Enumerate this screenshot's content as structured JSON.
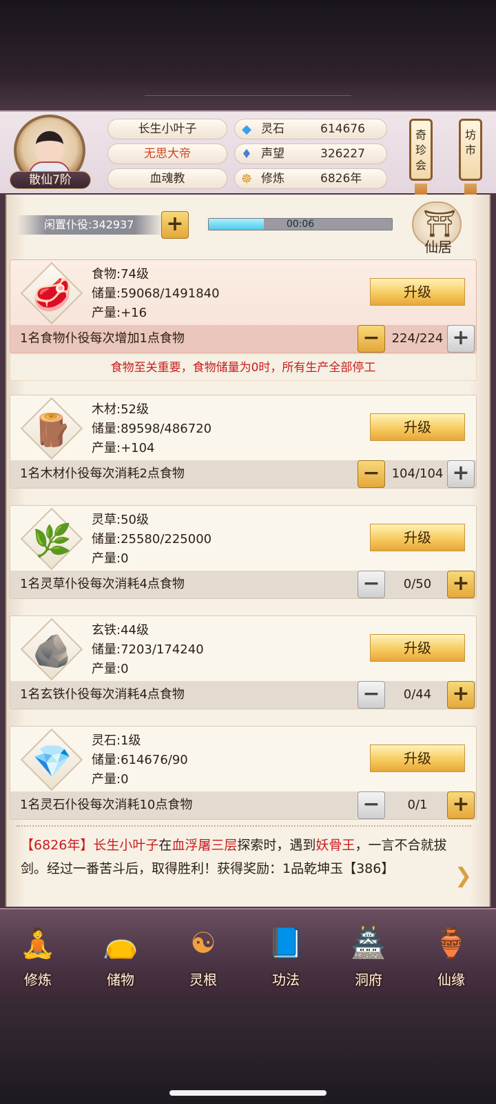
{
  "header": {
    "rank": "散仙7阶",
    "player_name": "长生小叶子",
    "title": "无思大帝",
    "sect": "血魂教",
    "stats": [
      {
        "label": "灵石",
        "value": "614676",
        "icon": "spirit-stone-icon",
        "glyph": "◆",
        "color": "#3aa0e8"
      },
      {
        "label": "声望",
        "value": "326227",
        "icon": "prestige-crystal-icon",
        "glyph": "♦",
        "color": "#4a7ed8"
      },
      {
        "label": "修炼",
        "value": "6826年",
        "icon": "meditation-icon",
        "glyph": "☸",
        "color": "#d89a2a"
      }
    ],
    "banners": [
      "奇珍会",
      "坊市"
    ]
  },
  "idle": {
    "label": "闲置仆役:342937",
    "timer": "00:06",
    "progress": 0.3,
    "xianju": "仙居"
  },
  "resources": [
    {
      "name": "食物:74级",
      "storage": "储量:59068/1491840",
      "output": "产量:+16",
      "desc": "1名食物仆役每次增加1点食物",
      "count": "224/224",
      "upgrade": "升级",
      "icon": "meat-icon",
      "glyph": "🥩"
    },
    {
      "name": "木材:52级",
      "storage": "储量:89598/486720",
      "output": "产量:+104",
      "desc": "1名木材仆役每次消耗2点食物",
      "count": "104/104",
      "upgrade": "升级",
      "icon": "logs-icon",
      "glyph": "🪵"
    },
    {
      "name": "灵草:50级",
      "storage": "储量:25580/225000",
      "output": "产量:0",
      "desc": "1名灵草仆役每次消耗4点食物",
      "count": "0/50",
      "upgrade": "升级",
      "icon": "herb-icon",
      "glyph": "🌿"
    },
    {
      "name": "玄铁:44级",
      "storage": "储量:7203/174240",
      "output": "产量:0",
      "desc": "1名玄铁仆役每次消耗4点食物",
      "count": "0/44",
      "upgrade": "升级",
      "icon": "iron-ore-icon",
      "glyph": "🪨"
    },
    {
      "name": "灵石:1级",
      "storage": "储量:614676/90",
      "output": "产量:0",
      "desc": "1名灵石仆役每次消耗10点食物",
      "count": "0/1",
      "upgrade": "升级",
      "icon": "spirit-crystal-icon",
      "glyph": "💎"
    }
  ],
  "warning": "食物至关重要，食物储量为0时，所有生产全部停工",
  "log": {
    "year": "【6826年】",
    "player": "长生小叶子",
    "t1": "在",
    "place": "血浮屠三层",
    "t2": "探索时，遇到",
    "enemy": "妖骨王",
    "t3": "，一言不合就拔剑。经过一番苦斗后，取得胜利！获得奖励：1品乾坤玉【386】"
  },
  "nav": [
    {
      "label": "修炼",
      "icon": "cultivate-icon",
      "glyph": "🧘"
    },
    {
      "label": "储物",
      "icon": "storage-bag-icon",
      "glyph": "👝"
    },
    {
      "label": "灵根",
      "icon": "spirit-root-icon",
      "glyph": "☯"
    },
    {
      "label": "功法",
      "icon": "scripture-book-icon",
      "glyph": "📘"
    },
    {
      "label": "洞府",
      "icon": "cave-mansion-icon",
      "glyph": "🏯"
    },
    {
      "label": "仙缘",
      "icon": "fortune-gourd-icon",
      "glyph": "🏺"
    }
  ]
}
